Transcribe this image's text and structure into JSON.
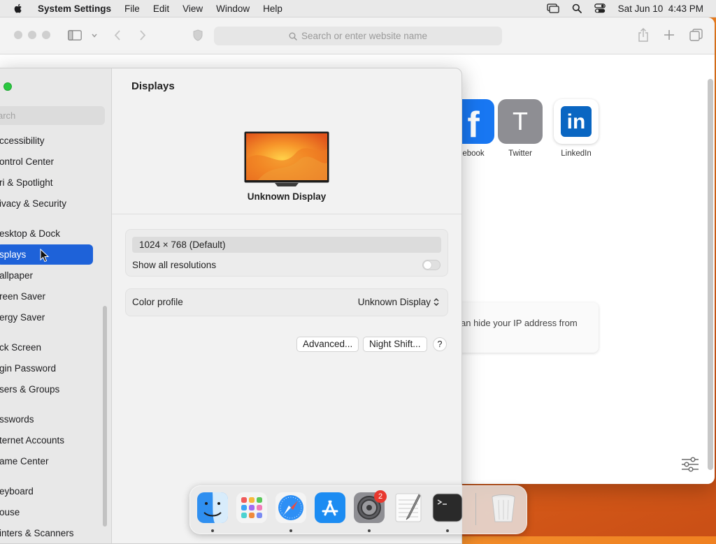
{
  "menubar": {
    "app": "System Settings",
    "items": [
      "File",
      "Edit",
      "View",
      "Window",
      "Help"
    ],
    "datetime": "Sat Jun 10  4:43 PM"
  },
  "safari": {
    "url_placeholder": "Search or enter website name",
    "favorites": [
      {
        "label": "ebook",
        "tile_text": "f"
      },
      {
        "label": "Twitter",
        "tile_text": "T"
      },
      {
        "label": "LinkedIn",
        "tile_text": "in"
      }
    ],
    "privacy_text": "an hide your IP address from"
  },
  "sidebar": {
    "search_placeholder": "arch",
    "items": [
      {
        "label": "ccessibility"
      },
      {
        "label": "ontrol Center"
      },
      {
        "label": "ri & Spotlight"
      },
      {
        "label": "ivacy & Security"
      },
      {
        "label": "esktop & Dock"
      },
      {
        "label": "splays",
        "selected": true
      },
      {
        "label": "allpaper"
      },
      {
        "label": "reen Saver"
      },
      {
        "label": "ergy Saver"
      },
      {
        "label": "ck Screen"
      },
      {
        "label": "gin Password"
      },
      {
        "label": "sers & Groups"
      },
      {
        "label": "sswords"
      },
      {
        "label": "ternet Accounts"
      },
      {
        "label": "ame Center"
      },
      {
        "label": "eyboard"
      },
      {
        "label": "ouse"
      },
      {
        "label": "inters & Scanners"
      }
    ]
  },
  "displays": {
    "title": "Displays",
    "display_name": "Unknown Display",
    "resolution": "1024 × 768 (Default)",
    "show_all_label": "Show all resolutions",
    "show_all_on": false,
    "color_profile_label": "Color profile",
    "color_profile_value": "Unknown Display",
    "advanced_label": "Advanced...",
    "night_shift_label": "Night Shift...",
    "help_label": "?"
  },
  "dock": {
    "apps": [
      "Finder",
      "Launchpad",
      "Safari",
      "App Store",
      "System Settings",
      "TextEdit",
      "Terminal",
      "Trash"
    ],
    "settings_badge": "2"
  }
}
